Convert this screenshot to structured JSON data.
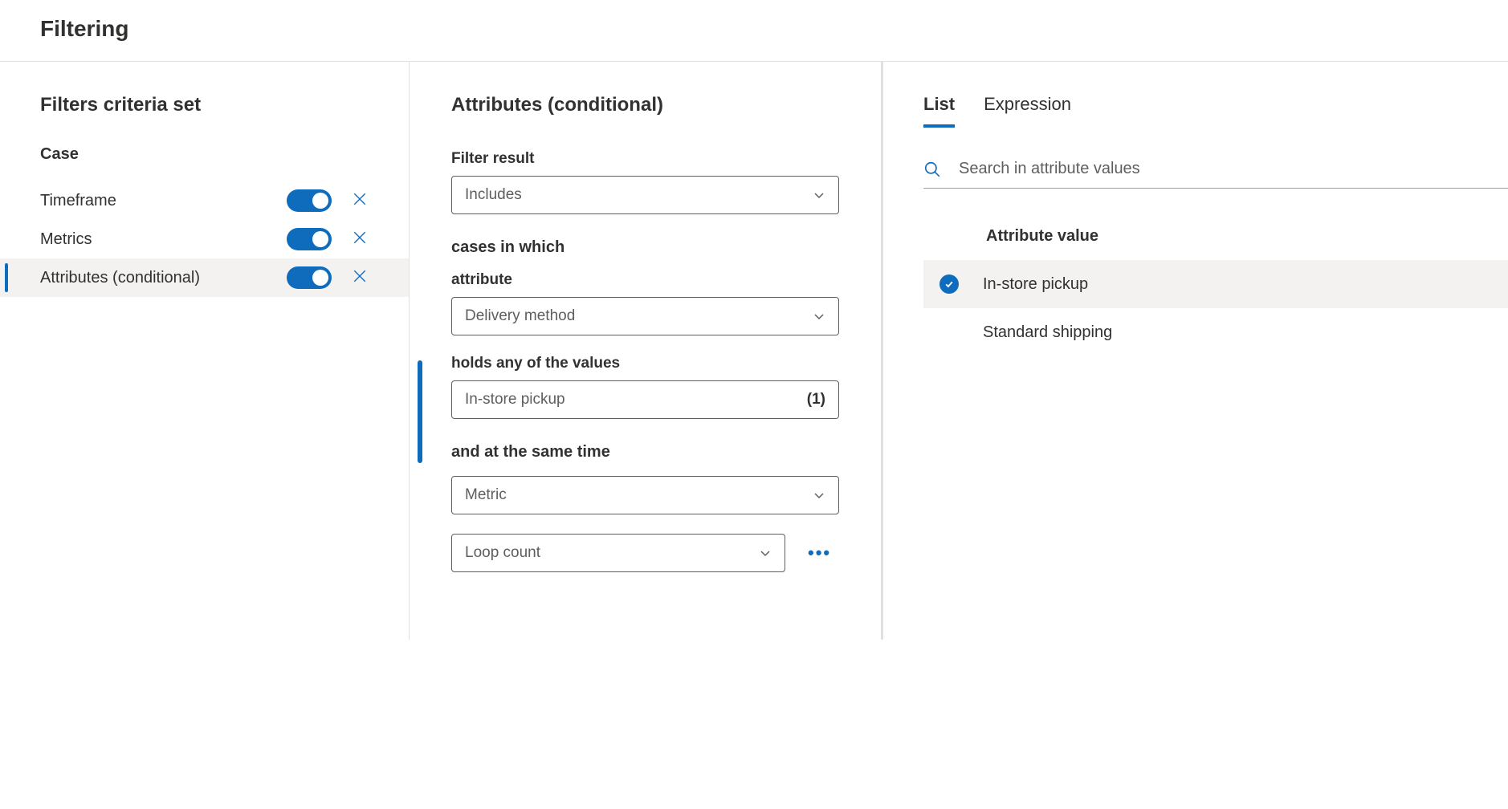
{
  "page_title": "Filtering",
  "left": {
    "section_title": "Filters criteria set",
    "group_title": "Case",
    "items": [
      {
        "label": "Timeframe",
        "enabled": true,
        "selected": false
      },
      {
        "label": "Metrics",
        "enabled": true,
        "selected": false
      },
      {
        "label": "Attributes (conditional)",
        "enabled": true,
        "selected": true
      }
    ]
  },
  "mid": {
    "title": "Attributes (conditional)",
    "filter_result_label": "Filter result",
    "filter_result_value": "Includes",
    "cases_text": "cases in which",
    "attribute_label": "attribute",
    "attribute_value": "Delivery method",
    "holds_label": "holds any of the values",
    "holds_value": "In-store pickup",
    "holds_count": "(1)",
    "and_text": "and at the same time",
    "metric_value": "Metric",
    "loop_value": "Loop count"
  },
  "right": {
    "tabs": {
      "list": "List",
      "expression": "Expression"
    },
    "search_placeholder": "Search in attribute values",
    "attr_header": "Attribute value",
    "values": [
      {
        "label": "In-store pickup",
        "checked": true
      },
      {
        "label": "Standard shipping",
        "checked": false
      }
    ]
  }
}
